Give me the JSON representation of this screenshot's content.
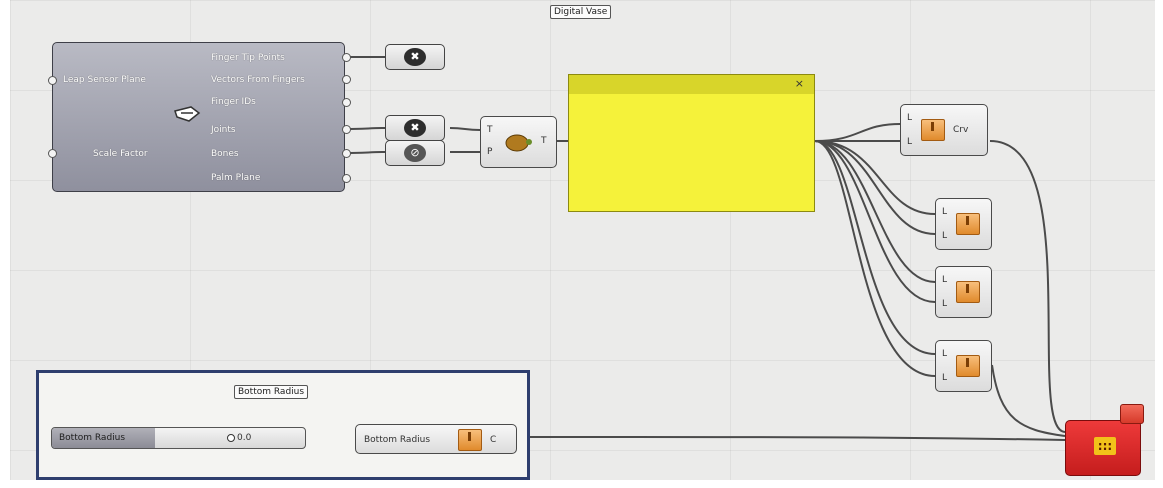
{
  "group_title": "Digital Vase",
  "leap": {
    "inputs": [
      "Leap Sensor Plane",
      "Scale Factor"
    ],
    "outputs": [
      "Finger Tip Points",
      "Vectors From Fingers",
      "Finger IDs",
      "Joints",
      "Bones",
      "Palm Plane"
    ]
  },
  "turtle": {
    "in_t": "T",
    "in_p": "P",
    "out": "T"
  },
  "panel": {
    "close": "×"
  },
  "curve": {
    "in_a": "L",
    "in_b": "L",
    "out": "Crv"
  },
  "lofts": [
    {
      "a": "L",
      "b": "L"
    },
    {
      "a": "L",
      "b": "L"
    },
    {
      "a": "L",
      "b": "L"
    }
  ],
  "bottom": {
    "title": "Bottom Radius",
    "slider_label": "Bottom Radius",
    "slider_value": "0.0",
    "param_label": "Bottom Radius",
    "param_out": "C"
  },
  "colors": {
    "accent_panel": "#f5f23a",
    "highlight_border": "#2e3e6e",
    "red_component": "#d62424"
  }
}
